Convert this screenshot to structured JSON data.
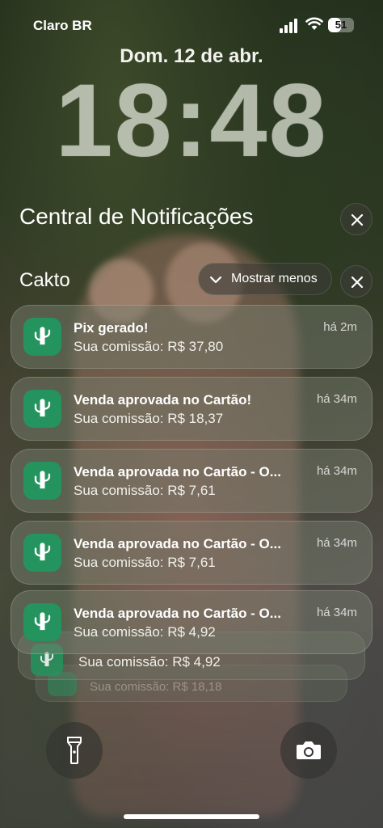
{
  "status_bar": {
    "carrier": "Claro BR",
    "battery_level": "51",
    "icons": [
      "signal-icon",
      "wifi-icon",
      "battery-icon"
    ]
  },
  "lock_screen": {
    "date": "Dom. 12 de abr.",
    "time": "18:48"
  },
  "notification_center": {
    "title": "Central de Notificações",
    "close_icon": "close-icon"
  },
  "group": {
    "app_name": "Cakto",
    "show_less_label": "Mostrar menos",
    "app_icon": "cactus-icon",
    "app_icon_color": "#25935d",
    "notifications": [
      {
        "title": "Pix gerado!",
        "body": "Sua comissão: R$ 37,80",
        "time": "há 2m"
      },
      {
        "title": "Venda aprovada no Cartão!",
        "body": "Sua comissão: R$ 18,37",
        "time": "há 34m"
      },
      {
        "title": "Venda aprovada no Cartão - O...",
        "body": "Sua comissão: R$ 7,61",
        "time": "há 34m"
      },
      {
        "title": "Venda aprovada no Cartão - O...",
        "body": "Sua comissão: R$ 7,61",
        "time": "há 34m"
      },
      {
        "title": "Venda aprovada no Cartão - O...",
        "body": "Sua comissão: R$ 4,92",
        "time": "há 34m"
      }
    ],
    "stacked": [
      {
        "body": "Sua comissão: R$ 4,92"
      },
      {
        "body": "Sua comissão: R$ 18,18"
      }
    ]
  },
  "quick_actions": {
    "left_icon": "flashlight-icon",
    "right_icon": "camera-icon"
  }
}
